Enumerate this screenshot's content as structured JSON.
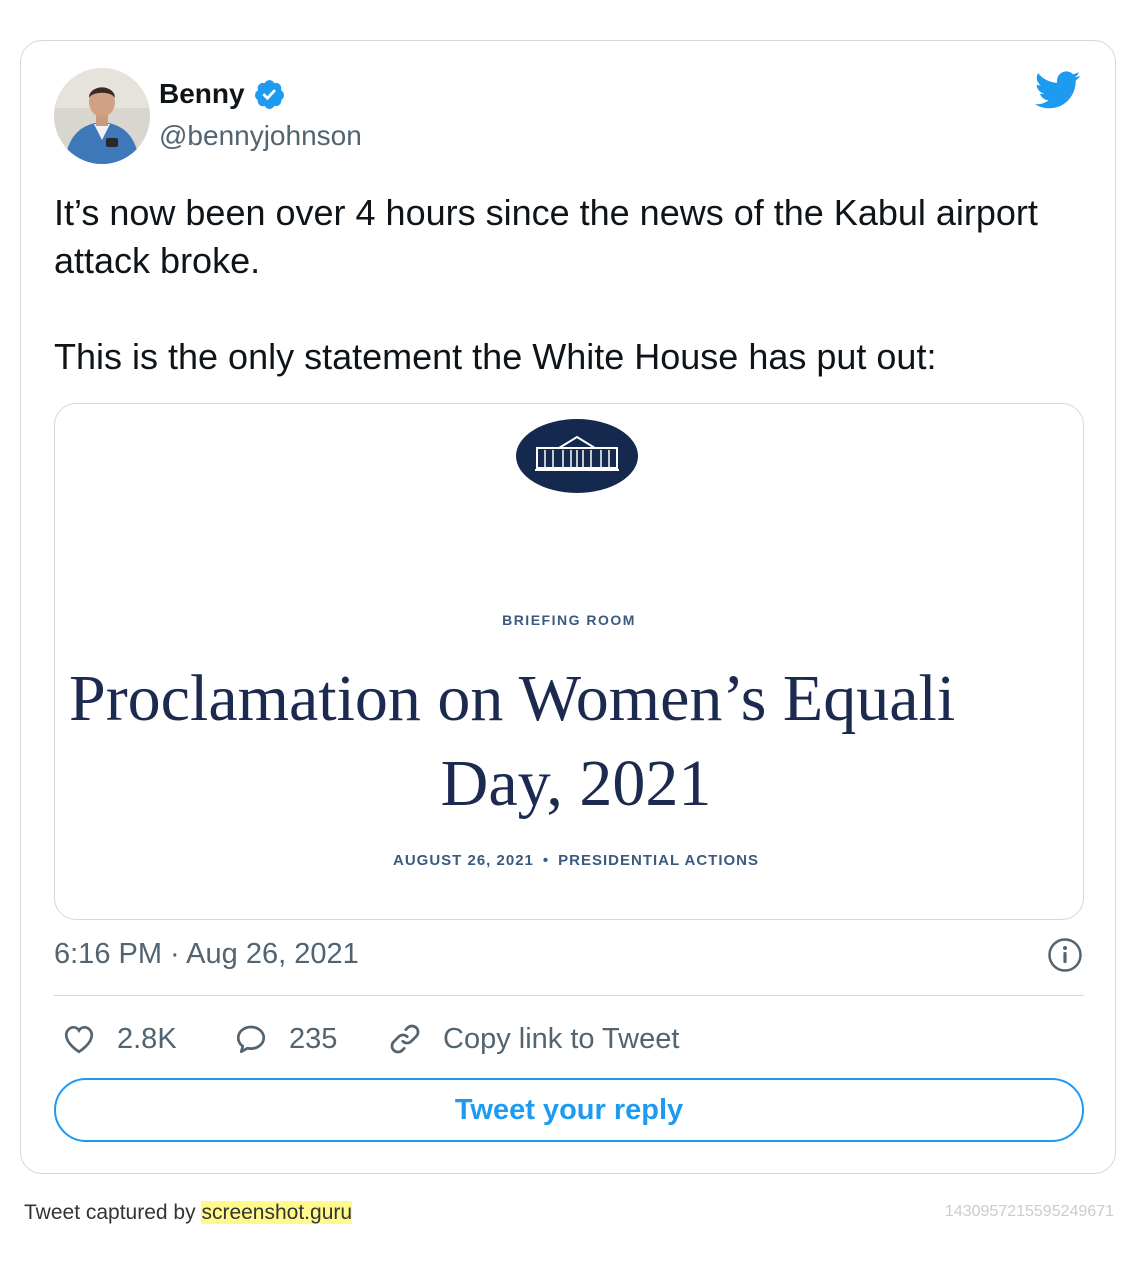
{
  "tweet": {
    "author": {
      "display_name": "Benny",
      "handle": "@bennyjohnson",
      "verified": true
    },
    "text": {
      "paragraph1": "It’s now been over 4 hours since the news of the Kabul airport attack broke.",
      "paragraph2": "This is the only statement the White House has put out:"
    },
    "media": {
      "section": "BRIEFING ROOM",
      "headline_line1": "Proclamation on Women’s Equali",
      "headline_line2": "Day, 2021",
      "date": "AUGUST 26, 2021",
      "separator": "•",
      "category": "PRESIDENTIAL ACTIONS"
    },
    "timestamp": "6:16 PM · Aug 26, 2021",
    "actions": {
      "likes": "2.8K",
      "replies": "235",
      "copy_link": "Copy link to Tweet"
    },
    "reply_button": "Tweet your reply"
  },
  "footer": {
    "captured_prefix": "Tweet captured by",
    "captured_site": "screenshot.guru",
    "tweet_id": "1430957215595249671"
  },
  "colors": {
    "twitter_blue": "#1d9bf0",
    "text_primary": "#0f1419",
    "text_secondary": "#536471",
    "border": "#cfd9de",
    "headline_navy": "#1d2a50",
    "highlight": "#fffa8b"
  },
  "icons": {
    "brand": "twitter-bird-icon",
    "verified": "verified-badge-icon",
    "info": "info-icon",
    "like": "heart-icon",
    "reply": "reply-bubble-icon",
    "copy": "link-icon"
  }
}
